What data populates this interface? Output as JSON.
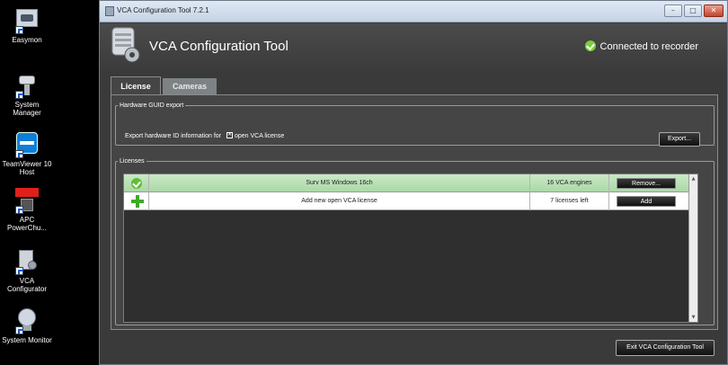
{
  "desktop": {
    "icons": [
      {
        "label": "Easymon",
        "icon": "camera-monitor-icon"
      },
      {
        "label": "System Manager",
        "icon": "security-camera-icon"
      },
      {
        "label": "TeamViewer 10 Host",
        "icon": "teamviewer-icon"
      },
      {
        "label": "APC PowerChu...",
        "icon": "apc-powerchute-icon"
      },
      {
        "label": "VCA Configurator",
        "icon": "server-gear-icon"
      },
      {
        "label": "System Monitor",
        "icon": "globe-monitor-icon"
      }
    ]
  },
  "window": {
    "title": "VCA Configuration Tool 7.2.1",
    "controls": {
      "minimize": "–",
      "maximize": "□",
      "close": "✕"
    }
  },
  "header": {
    "app_title": "VCA Configuration Tool",
    "status": "Connected to recorder"
  },
  "tabs": [
    {
      "label": "License",
      "active": true
    },
    {
      "label": "Cameras",
      "active": false
    }
  ],
  "hardware": {
    "legend": "Hardware GUID export",
    "text": "Export hardware ID information for",
    "checkbox_label": "open VCA license",
    "export_button": "Export..."
  },
  "licenses": {
    "legend": "Licenses",
    "rows": [
      {
        "name": "Surv MS Windows 16ch",
        "count": "16 VCA engines",
        "action": "Remove..."
      },
      {
        "name": "Add new open VCA license",
        "count": "7 licenses left",
        "action": "Add"
      }
    ]
  },
  "footer": {
    "exit_button": "Exit VCA Configuration Tool"
  },
  "colors": {
    "accent_green": "#7bcf3e",
    "row_highlight": "#c9e9c6",
    "panel_bg": "#454545"
  }
}
